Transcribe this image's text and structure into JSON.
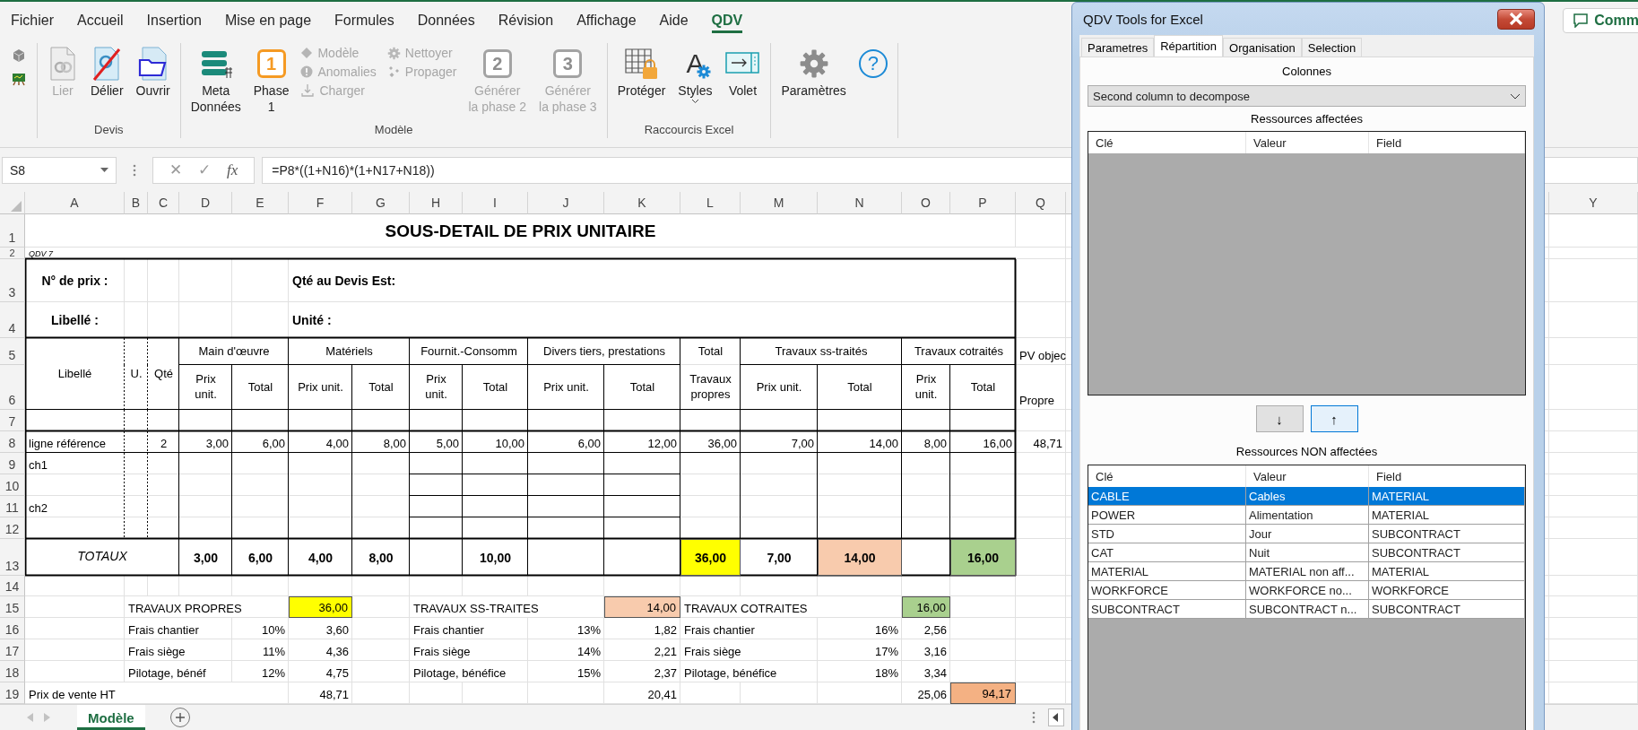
{
  "ribbon": {
    "tabs": [
      {
        "label": "Fichier",
        "selected": false
      },
      {
        "label": "Accueil",
        "selected": false
      },
      {
        "label": "Insertion",
        "selected": false
      },
      {
        "label": "Mise en page",
        "selected": false
      },
      {
        "label": "Formules",
        "selected": false
      },
      {
        "label": "Données",
        "selected": false
      },
      {
        "label": "Révision",
        "selected": false
      },
      {
        "label": "Affichage",
        "selected": false
      },
      {
        "label": "Aide",
        "selected": false
      },
      {
        "label": "QDV",
        "selected": true
      }
    ],
    "comments_button": {
      "label": "Comm"
    },
    "quick_icons": [
      {
        "kind": "cube"
      },
      {
        "kind": "easel"
      }
    ],
    "groups": [
      {
        "label": "Devis",
        "items": [
          {
            "kind": "link",
            "label": "Lier",
            "disabled": true
          },
          {
            "kind": "unlink",
            "label": "Délier",
            "disabled": false
          },
          {
            "kind": "folder",
            "label": "Ouvrir",
            "disabled": false
          }
        ]
      },
      {
        "label": "Modèle",
        "items": [
          {
            "kind": "meta",
            "label": "Meta\nDonnées",
            "disabled": false
          },
          {
            "kind": "phase",
            "badge": "1",
            "label": "Phase\n1",
            "disabled": false
          },
          {
            "kind": "stack",
            "children": [
              {
                "kind": "diamond",
                "label": "Modèle",
                "disabled": true
              },
              {
                "kind": "alert",
                "label": "Anomalies",
                "disabled": true
              },
              {
                "kind": "download",
                "label": "Charger",
                "disabled": true
              }
            ]
          },
          {
            "kind": "stack",
            "children": [
              {
                "kind": "cog",
                "label": "Nettoyer",
                "disabled": true
              },
              {
                "kind": "dots",
                "label": "Propager",
                "disabled": true
              }
            ]
          },
          {
            "kind": "generate",
            "badge": "2",
            "label": "Générer\nla phase 2",
            "disabled": true
          },
          {
            "kind": "generate",
            "badge": "3",
            "label": "Générer\nla phase 3",
            "disabled": true
          }
        ]
      },
      {
        "label": "Raccourcis Excel",
        "items": [
          {
            "kind": "protect",
            "label": "Protéger",
            "disabled": false
          },
          {
            "kind": "styles",
            "glyph": "A",
            "label": "Styles",
            "dropdown": true,
            "disabled": false
          },
          {
            "kind": "pane",
            "label": "Volet",
            "disabled": false
          }
        ]
      },
      {
        "items": [
          {
            "kind": "gear",
            "label": "Paramètres",
            "disabled": false
          },
          {
            "kind": "help",
            "glyph": "?",
            "disabled": false
          }
        ]
      }
    ]
  },
  "formula_bar": {
    "name_box": "S8",
    "cancel": "✕",
    "enter": "✓",
    "fx": "fx",
    "formula": "=P8*((1+N16)*(1+N17+N18))"
  },
  "sheet": {
    "columns": [
      "A",
      "B",
      "C",
      "D",
      "E",
      "F",
      "G",
      "H",
      "I",
      "J",
      "K",
      "L",
      "M",
      "N",
      "O",
      "P",
      "Q",
      "Y"
    ],
    "rows": [
      {
        "number": "1",
        "cells": [
          {
            "kind": "title",
            "text": "SOUS-DETAIL DE PRIX UNITAIRE"
          }
        ]
      },
      {
        "number": "2",
        "cells": [
          {
            "kind": "note",
            "text": "QDV 7"
          }
        ]
      },
      {
        "number": "3",
        "cells": [
          {
            "kind": "field",
            "text": "N° de prix :"
          },
          null,
          null,
          null,
          null,
          {
            "kind": "field",
            "text": "Qté au Devis Est:"
          }
        ]
      },
      {
        "number": "4",
        "cells": [
          {
            "kind": "field",
            "text": "Libellé :"
          },
          null,
          null,
          null,
          null,
          {
            "kind": "field",
            "text": "Unité :"
          }
        ]
      },
      {
        "number": "5",
        "cells": [
          {
            "kind": "head",
            "text": "Libellé"
          },
          {
            "kind": "head",
            "text": "U."
          },
          {
            "kind": "head",
            "text": "Qté"
          },
          {
            "kind": "head",
            "text": "Main d'œuvre"
          },
          null,
          {
            "kind": "head",
            "text": "Matériels"
          },
          null,
          {
            "kind": "head",
            "text": "Fournit.-Consomm"
          },
          null,
          {
            "kind": "head",
            "text": "Divers tiers, prestations"
          },
          null,
          {
            "kind": "head",
            "text": "Total"
          },
          {
            "kind": "head",
            "text": "Travaux ss-traités"
          },
          null,
          {
            "kind": "head",
            "text": "Travaux cotraités"
          },
          null,
          {
            "kind": "text",
            "text": "PV objec"
          }
        ]
      },
      {
        "number": "6",
        "cells": [
          null,
          null,
          null,
          {
            "kind": "head",
            "text": "Prix unit."
          },
          {
            "kind": "head",
            "text": "Total"
          },
          {
            "kind": "head",
            "text": "Prix unit."
          },
          {
            "kind": "head",
            "text": "Total"
          },
          {
            "kind": "head",
            "text": "Prix unit."
          },
          {
            "kind": "head",
            "text": "Total"
          },
          {
            "kind": "head",
            "text": "Prix unit."
          },
          {
            "kind": "head",
            "text": "Total"
          },
          {
            "kind": "head",
            "text": "Travaux propres"
          },
          {
            "kind": "head",
            "text": "Prix unit."
          },
          {
            "kind": "head",
            "text": "Total"
          },
          {
            "kind": "head",
            "text": "Prix unit."
          },
          {
            "kind": "head",
            "text": "Total"
          },
          {
            "kind": "text",
            "text": "Propre"
          }
        ]
      },
      {
        "number": "7"
      },
      {
        "number": "8",
        "cells": [
          {
            "kind": "text",
            "text": "ligne référence"
          },
          null,
          {
            "kind": "center",
            "text": "2"
          },
          {
            "kind": "num",
            "text": "3,00"
          },
          {
            "kind": "num",
            "text": "6,00"
          },
          {
            "kind": "num",
            "text": "4,00"
          },
          {
            "kind": "num",
            "text": "8,00"
          },
          {
            "kind": "num",
            "text": "5,00"
          },
          {
            "kind": "num",
            "text": "10,00"
          },
          {
            "kind": "num",
            "text": "6,00"
          },
          {
            "kind": "num",
            "text": "12,00"
          },
          {
            "kind": "num",
            "text": "36,00"
          },
          {
            "kind": "num",
            "text": "7,00"
          },
          {
            "kind": "num",
            "text": "14,00"
          },
          {
            "kind": "num",
            "text": "8,00"
          },
          {
            "kind": "num",
            "text": "16,00"
          },
          {
            "kind": "num",
            "text": "48,71"
          }
        ]
      },
      {
        "number": "9",
        "cells": [
          {
            "kind": "text",
            "text": "ch1"
          }
        ]
      },
      {
        "number": "10"
      },
      {
        "number": "11",
        "cells": [
          {
            "kind": "text",
            "text": "ch2"
          }
        ]
      },
      {
        "number": "12"
      },
      {
        "number": "13",
        "cells": [
          {
            "kind": "total-label",
            "text": "TOTAUX"
          },
          null,
          null,
          {
            "kind": "total",
            "text": "3,00"
          },
          {
            "kind": "total",
            "text": "6,00"
          },
          {
            "kind": "total",
            "text": "4,00"
          },
          {
            "kind": "total",
            "text": "8,00"
          },
          null,
          {
            "kind": "total",
            "text": "10,00"
          },
          null,
          null,
          {
            "kind": "total",
            "text": "36,00",
            "color": "#ffff00"
          },
          {
            "kind": "total",
            "text": "7,00"
          },
          {
            "kind": "total",
            "text": "14,00",
            "color": "#f8cbad"
          },
          null,
          {
            "kind": "total",
            "text": "16,00",
            "color": "#a9d08e"
          }
        ]
      },
      {
        "number": "14"
      },
      {
        "number": "15",
        "cells": [
          null,
          {
            "kind": "text",
            "text": "TRAVAUX PROPRES"
          },
          null,
          null,
          null,
          {
            "kind": "num",
            "text": "36,00",
            "color": "#ffff00"
          },
          null,
          {
            "kind": "text",
            "text": "TRAVAUX SS-TRAITES"
          },
          null,
          null,
          {
            "kind": "num",
            "text": "14,00",
            "color": "#f8cbad"
          },
          {
            "kind": "text",
            "text": "TRAVAUX COTRAITES"
          },
          null,
          null,
          {
            "kind": "num",
            "text": "16,00",
            "color": "#a9d08e"
          }
        ]
      },
      {
        "number": "16",
        "cells": [
          null,
          {
            "kind": "text",
            "text": "Frais chantier"
          },
          null,
          null,
          {
            "kind": "num",
            "text": "10%"
          },
          {
            "kind": "num",
            "text": "3,60"
          },
          null,
          {
            "kind": "text",
            "text": "Frais chantier"
          },
          null,
          {
            "kind": "num",
            "text": "13%"
          },
          {
            "kind": "num",
            "text": "1,82"
          },
          {
            "kind": "text",
            "text": "Frais chantier"
          },
          null,
          {
            "kind": "num",
            "text": "16%"
          },
          {
            "kind": "num",
            "text": "2,56"
          }
        ]
      },
      {
        "number": "17",
        "cells": [
          null,
          {
            "kind": "text",
            "text": "Frais siège"
          },
          null,
          null,
          {
            "kind": "num",
            "text": "11%"
          },
          {
            "kind": "num",
            "text": "4,36"
          },
          null,
          {
            "kind": "text",
            "text": "Frais siège"
          },
          null,
          {
            "kind": "num",
            "text": "14%"
          },
          {
            "kind": "num",
            "text": "2,21"
          },
          {
            "kind": "text",
            "text": "Frais siège"
          },
          null,
          {
            "kind": "num",
            "text": "17%"
          },
          {
            "kind": "num",
            "text": "3,16"
          }
        ]
      },
      {
        "number": "18",
        "cells": [
          null,
          {
            "kind": "text",
            "text": "Pilotage, bénéf"
          },
          null,
          null,
          {
            "kind": "num",
            "text": "12%"
          },
          {
            "kind": "num",
            "text": "4,75"
          },
          null,
          {
            "kind": "text",
            "text": "Pilotage, bénéfice"
          },
          null,
          {
            "kind": "num",
            "text": "15%"
          },
          {
            "kind": "num",
            "text": "2,37"
          },
          {
            "kind": "text",
            "text": "Pilotage, bénéfice"
          },
          null,
          {
            "kind": "num",
            "text": "18%"
          },
          {
            "kind": "num",
            "text": "3,34"
          }
        ]
      },
      {
        "number": "19",
        "cells": [
          {
            "kind": "text",
            "text": "Prix de vente HT"
          },
          null,
          null,
          null,
          null,
          {
            "kind": "num",
            "text": "48,71"
          },
          null,
          null,
          null,
          null,
          {
            "kind": "num",
            "text": "20,41"
          },
          null,
          null,
          null,
          {
            "kind": "num",
            "text": "25,06"
          },
          {
            "kind": "num",
            "text": "94,17",
            "color": "#f4b183"
          }
        ]
      }
    ]
  },
  "sheet_tabs": [
    {
      "label": "Modèle",
      "selected": true
    }
  ],
  "dialog": {
    "title": "QDV Tools for Excel",
    "tabs": [
      {
        "label": "Parametres",
        "selected": false
      },
      {
        "label": "Répartition",
        "selected": true
      },
      {
        "label": "Organisation",
        "selected": false
      },
      {
        "label": "Selection",
        "selected": false
      }
    ],
    "columns_label": "Colonnes",
    "column_select": "Second column to decompose",
    "assigned": {
      "label": "Ressources affectées",
      "columns": [
        "Clé",
        "Valeur",
        "Field"
      ]
    },
    "move_buttons": [
      {
        "label": "↓",
        "focused": false
      },
      {
        "label": "↑",
        "focused": true
      }
    ],
    "unassigned": {
      "label": "Ressources NON affectées",
      "columns": [
        "Clé",
        "Valeur",
        "Field"
      ],
      "rows": [
        {
          "cells": [
            "CABLE",
            "Cables",
            "MATERIAL"
          ],
          "selected": true
        },
        {
          "cells": [
            "POWER",
            "Alimentation",
            "MATERIAL"
          ],
          "selected": false
        },
        {
          "cells": [
            "STD",
            "Jour",
            "SUBCONTRACT"
          ],
          "selected": false
        },
        {
          "cells": [
            "CAT",
            "Nuit",
            "SUBCONTRACT"
          ],
          "selected": false
        },
        {
          "cells": [
            "MATERIAL",
            "MATERIAL non aff...",
            "MATERIAL"
          ],
          "selected": false
        },
        {
          "cells": [
            "WORKFORCE",
            "WORKFORCE no...",
            "WORKFORCE"
          ],
          "selected": false
        },
        {
          "cells": [
            "SUBCONTRACT",
            "SUBCONTRACT n...",
            "SUBCONTRACT"
          ],
          "selected": false
        }
      ]
    }
  }
}
